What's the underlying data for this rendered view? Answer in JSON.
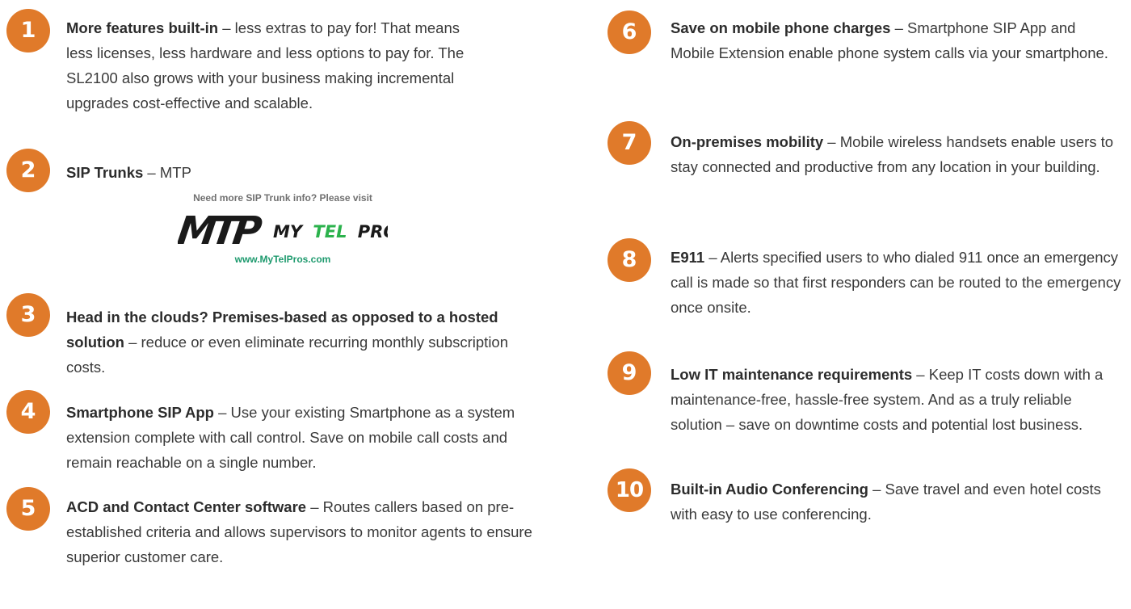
{
  "colors": {
    "badge": "#e07a2a",
    "body_text": "#3a3a3a",
    "logo_green": "#2bb24c",
    "url_green": "#1e9a6e"
  },
  "items": [
    {
      "number": "1",
      "title": "More features built-in",
      "body": " – less extras to pay for! That means less licenses, less hardware and less options to pay for. The SL2100 also grows with your business making incremental upgrades cost-effective and scalable."
    },
    {
      "number": "2",
      "title": "SIP Trunks",
      "body": " – MTP"
    },
    {
      "number": "3",
      "title": "Head in the clouds? Premises-based as opposed to a hosted solution",
      "body": " – reduce or even eliminate recurring monthly subscription costs."
    },
    {
      "number": "4",
      "title": "Smartphone SIP App",
      "body": " – Use your existing Smartphone as a system extension complete with call control. Save on mobile call costs and remain reachable on a single number."
    },
    {
      "number": "5",
      "title": "ACD and Contact Center software",
      "body": " – Routes callers based on pre-established criteria and allows supervisors to monitor agents to ensure superior customer care."
    },
    {
      "number": "6",
      "title": "Save on mobile phone charges",
      "body": " – Smartphone SIP App and Mobile Extension enable phone system calls via your smartphone."
    },
    {
      "number": "7",
      "title": "On-premises mobility",
      "body": " – Mobile wireless handsets enable users to stay connected and productive from any location in your building."
    },
    {
      "number": "8",
      "title": "E911",
      "body": " – Alerts specified users to who dialed 911 once an emergency call is made so that first responders can be routed to the emergency once onsite."
    },
    {
      "number": "9",
      "title": "Low IT maintenance requirements",
      "body": " – Keep IT costs down with a maintenance-free, hassle-free system. And as a truly reliable solution – save on downtime costs and potential lost business."
    },
    {
      "number": "10",
      "title": "Built-in Audio Conferencing",
      "body": " – Save travel and even hotel costs with easy to use conferencing."
    }
  ],
  "mtp": {
    "intro": "Need more SIP Trunk info? Please visit",
    "logo_mark": "MTP",
    "logo_word_1": "MY",
    "logo_word_2": "TEL",
    "logo_word_3": "PROS",
    "url": "www.MyTelPros.com"
  }
}
